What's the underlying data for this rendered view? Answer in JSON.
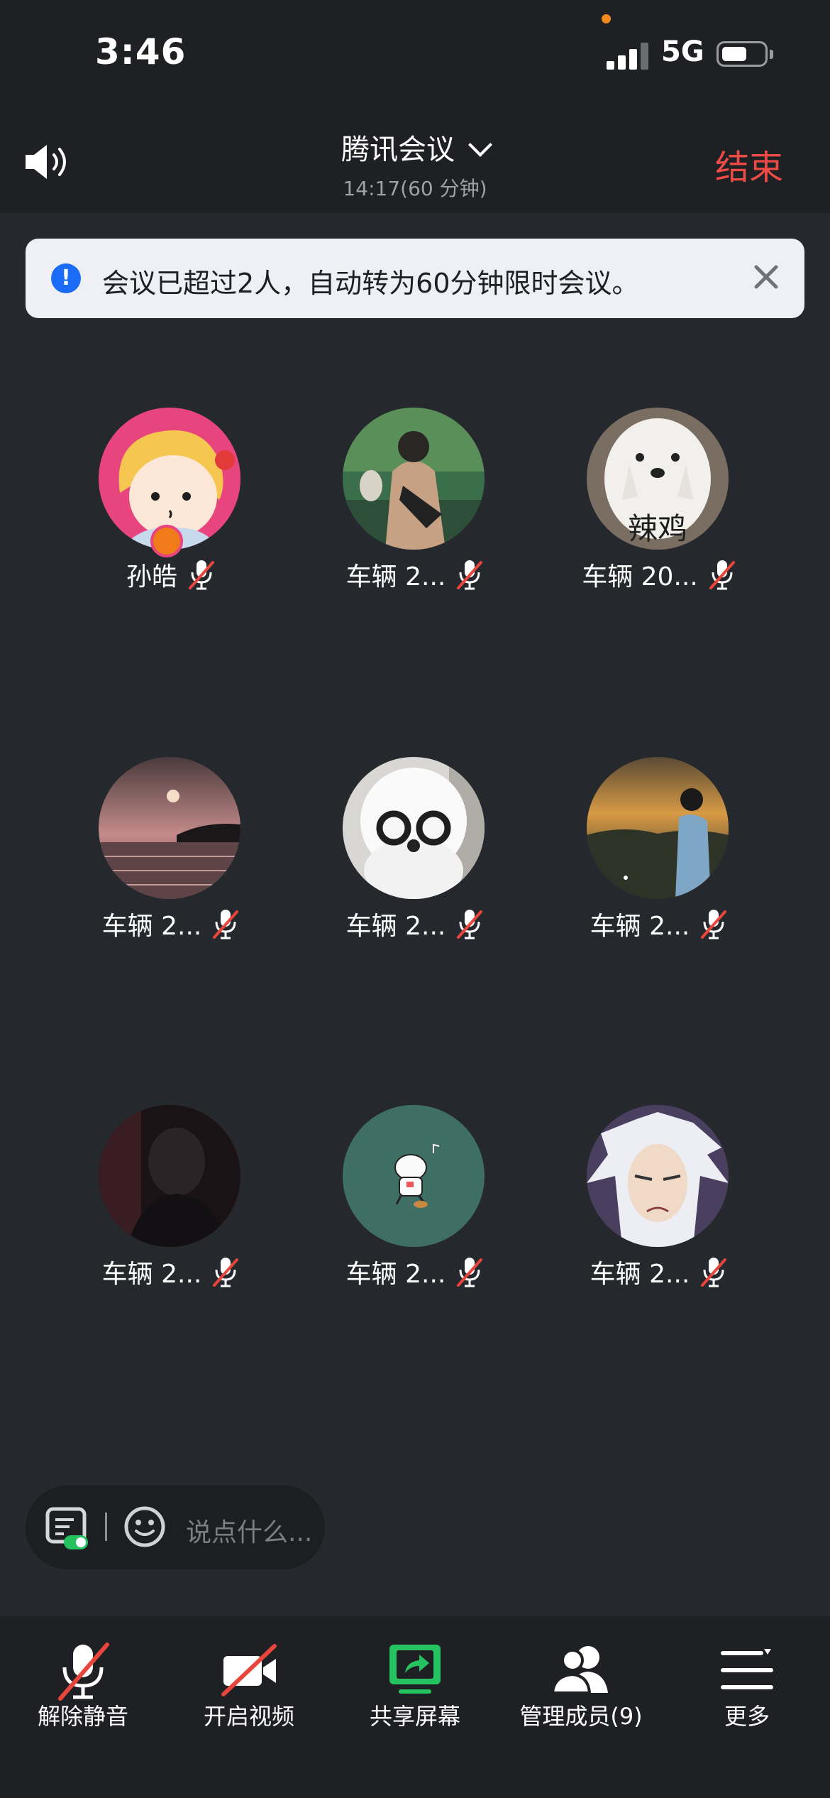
{
  "status_bar": {
    "time": "3:46",
    "network": "5G"
  },
  "header": {
    "title": "腾讯会议",
    "subtitle": "14:17(60 分钟)",
    "end_label": "结束"
  },
  "banner": {
    "text": "会议已超过2人，自动转为60分钟限时会议。"
  },
  "participants": [
    {
      "name": "孙皓"
    },
    {
      "name": "车辆 2..."
    },
    {
      "name": "车辆 20..."
    },
    {
      "name": "车辆 2..."
    },
    {
      "name": "车辆 2..."
    },
    {
      "name": "车辆 2..."
    },
    {
      "name": "车辆 2..."
    },
    {
      "name": "车辆 2..."
    },
    {
      "name": "车辆 2..."
    }
  ],
  "avatar_texts": {
    "dog_caption": "辣鸡"
  },
  "chat": {
    "placeholder": "说点什么..."
  },
  "toolbar": {
    "unmute": "解除静音",
    "video": "开启视频",
    "share": "共享屏幕",
    "members": "管理成员(9)",
    "more": "更多"
  },
  "colors": {
    "accent_green": "#24c35f",
    "end_red": "#ee4b46",
    "info_blue": "#1a6cf6",
    "muted_red": "#e8453c"
  }
}
